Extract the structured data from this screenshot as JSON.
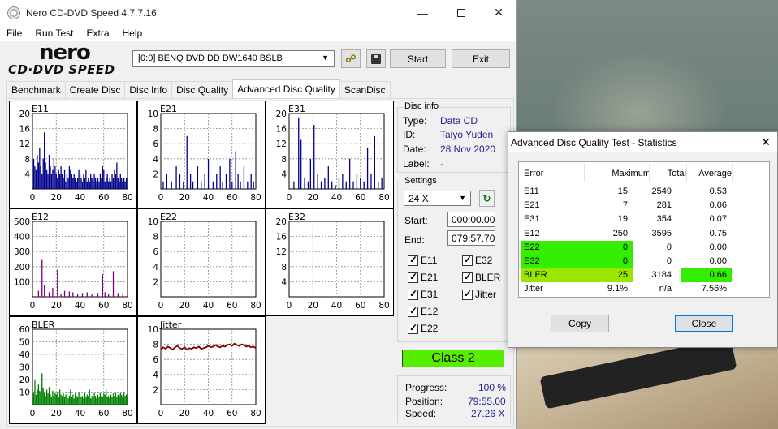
{
  "window": {
    "title": "Nero CD-DVD Speed 4.7.7.16"
  },
  "logo": {
    "line1": "nero",
    "line2": "CD·DVD SPEED"
  },
  "menu": [
    "File",
    "Run Test",
    "Extra",
    "Help"
  ],
  "toolbar": {
    "drive": "[0:0]   BENQ DVD DD DW1640 BSLB",
    "start_label": "Start",
    "exit_label": "Exit"
  },
  "tabs": [
    "Benchmark",
    "Create Disc",
    "Disc Info",
    "Disc Quality",
    "Advanced Disc Quality",
    "ScanDisc"
  ],
  "active_tab": "Advanced Disc Quality",
  "chart_data": [
    {
      "type": "bar",
      "label": "E11",
      "color": "#00008b",
      "ylim": [
        0,
        20
      ],
      "yticks": [
        4,
        8,
        12,
        16,
        20
      ],
      "xticks": [
        0,
        20,
        40,
        60,
        80
      ],
      "x": [
        1,
        2,
        3,
        4,
        5,
        6,
        7,
        8,
        9,
        10,
        11,
        12,
        13,
        14,
        15,
        16,
        17,
        18,
        19,
        20,
        21,
        22,
        23,
        24,
        25,
        26,
        27,
        28,
        29,
        30,
        31,
        32,
        33,
        34,
        35,
        36,
        37,
        38,
        39,
        40,
        41,
        42,
        43,
        44,
        45,
        46,
        47,
        48,
        49,
        50,
        51,
        52,
        53,
        54,
        55,
        56,
        57,
        58,
        59,
        60,
        61,
        62,
        63,
        64,
        65,
        66,
        67,
        68,
        69,
        70,
        71,
        72,
        73,
        74,
        75,
        76,
        77,
        78,
        79
      ],
      "values": [
        8,
        6,
        5,
        9,
        7,
        11,
        6,
        4,
        8,
        15,
        7,
        5,
        4,
        9,
        6,
        4,
        5,
        8,
        6,
        4,
        3,
        5,
        4,
        6,
        4,
        3,
        5,
        2,
        4,
        3,
        6,
        5,
        4,
        3,
        4,
        3,
        2,
        3,
        5,
        4,
        3,
        2,
        4,
        3,
        5,
        2,
        3,
        2,
        4,
        3,
        2,
        4,
        3,
        2,
        3,
        2,
        4,
        3,
        6,
        5,
        2,
        3,
        4,
        2,
        3,
        2,
        4,
        3,
        5,
        4,
        7,
        3,
        2,
        4,
        3,
        2,
        3,
        2,
        3
      ]
    },
    {
      "type": "bar",
      "label": "E21",
      "color": "#00008b",
      "ylim": [
        0,
        10
      ],
      "yticks": [
        2,
        4,
        6,
        8,
        10
      ],
      "xticks": [
        0,
        20,
        40,
        60,
        80
      ],
      "x": [
        2,
        5,
        9,
        13,
        16,
        19,
        22,
        25,
        27,
        31,
        34,
        37,
        40,
        44,
        47,
        50,
        52,
        55,
        58,
        60,
        63,
        65,
        67,
        70,
        73,
        76,
        78
      ],
      "values": [
        1,
        2,
        1,
        3,
        2,
        1,
        7,
        2,
        1,
        3,
        1,
        2,
        4,
        1,
        2,
        3,
        1,
        2,
        4,
        1,
        5,
        2,
        1,
        3,
        1,
        2,
        1
      ]
    },
    {
      "type": "bar",
      "label": "E31",
      "color": "#00008b",
      "ylim": [
        0,
        20
      ],
      "yticks": [
        4,
        8,
        12,
        16,
        20
      ],
      "xticks": [
        0,
        20,
        40,
        60,
        80
      ],
      "x": [
        4,
        8,
        10,
        13,
        16,
        18,
        21,
        24,
        27,
        30,
        33,
        36,
        39,
        42,
        45,
        48,
        51,
        54,
        57,
        60,
        63,
        66,
        69,
        72,
        75,
        78
      ],
      "values": [
        2,
        19,
        13,
        3,
        2,
        8,
        17,
        4,
        2,
        3,
        6,
        2,
        1,
        3,
        4,
        2,
        8,
        2,
        4,
        3,
        2,
        11,
        4,
        14,
        2,
        3
      ]
    },
    {
      "type": "bar",
      "label": "E12",
      "color": "#800080",
      "ylim": [
        0,
        500
      ],
      "yticks": [
        100,
        200,
        300,
        400,
        500
      ],
      "xticks": [
        0,
        20,
        40,
        60,
        80
      ],
      "x": [
        5,
        8,
        10,
        14,
        17,
        21,
        24,
        27,
        31,
        34,
        38,
        42,
        46,
        50,
        55,
        59,
        61,
        64,
        68,
        72,
        76
      ],
      "values": [
        40,
        250,
        80,
        30,
        60,
        180,
        20,
        40,
        35,
        30,
        20,
        25,
        30,
        20,
        25,
        150,
        30,
        20,
        170,
        25,
        20
      ]
    },
    {
      "type": "bar",
      "label": "E22",
      "color": "#800080",
      "ylim": [
        0,
        10
      ],
      "yticks": [
        2,
        4,
        6,
        8,
        10
      ],
      "xticks": [
        0,
        20,
        40,
        60,
        80
      ],
      "x": [],
      "values": []
    },
    {
      "type": "bar",
      "label": "E32",
      "color": "#800080",
      "ylim": [
        0,
        20
      ],
      "yticks": [
        4,
        8,
        12,
        16,
        20
      ],
      "xticks": [
        0,
        20,
        40,
        60,
        80
      ],
      "x": [],
      "values": []
    },
    {
      "type": "bar",
      "label": "BLER",
      "color": "#008000",
      "ylim": [
        0,
        60
      ],
      "yticks": [
        10,
        20,
        30,
        40,
        50,
        60
      ],
      "xticks": [
        0,
        20,
        40,
        60,
        80
      ],
      "x": [
        1,
        2,
        3,
        4,
        5,
        6,
        7,
        8,
        9,
        10,
        11,
        12,
        13,
        14,
        15,
        16,
        17,
        18,
        19,
        20,
        21,
        22,
        23,
        24,
        25,
        26,
        27,
        28,
        29,
        30,
        31,
        32,
        33,
        34,
        35,
        36,
        37,
        38,
        39,
        40,
        41,
        42,
        43,
        44,
        45,
        46,
        47,
        48,
        49,
        50,
        51,
        52,
        53,
        54,
        55,
        56,
        57,
        58,
        59,
        60,
        61,
        62,
        63,
        64,
        65,
        66,
        67,
        68,
        69,
        70,
        71,
        72,
        73,
        74,
        75,
        76,
        77,
        78,
        79
      ],
      "values": [
        10,
        20,
        8,
        12,
        16,
        11,
        9,
        25,
        13,
        10,
        7,
        12,
        9,
        14,
        8,
        6,
        11,
        7,
        9,
        8,
        10,
        6,
        12,
        8,
        7,
        9,
        6,
        8,
        10,
        5,
        7,
        12,
        6,
        8,
        5,
        9,
        7,
        6,
        10,
        8,
        6,
        7,
        5,
        9,
        6,
        8,
        7,
        12,
        5,
        7,
        6,
        9,
        7,
        5,
        8,
        6,
        10,
        7,
        6,
        9,
        8,
        12,
        6,
        7,
        5,
        8,
        6,
        9,
        7,
        10,
        6,
        8,
        7,
        9,
        8,
        6,
        10,
        7,
        8
      ]
    },
    {
      "type": "line",
      "label": "Jitter",
      "color": "#800000",
      "ylim": [
        0,
        10
      ],
      "yticks": [
        2,
        4,
        6,
        8,
        10
      ],
      "xticks": [
        0,
        20,
        40,
        60,
        80
      ],
      "x": [
        0,
        2,
        4,
        6,
        8,
        10,
        12,
        14,
        16,
        18,
        20,
        22,
        24,
        26,
        28,
        30,
        32,
        34,
        36,
        38,
        40,
        42,
        44,
        46,
        48,
        50,
        52,
        54,
        56,
        58,
        60,
        62,
        64,
        66,
        68,
        70,
        72,
        74,
        76,
        78,
        80
      ],
      "values": [
        7.3,
        7.6,
        7.4,
        7.7,
        7.5,
        7.3,
        7.6,
        7.8,
        7.5,
        7.4,
        7.6,
        7.3,
        7.5,
        7.4,
        7.6,
        7.5,
        7.7,
        7.4,
        7.5,
        7.6,
        7.8,
        7.6,
        7.7,
        7.9,
        7.7,
        7.6,
        7.8,
        7.7,
        7.9,
        8.0,
        7.8,
        8.1,
        7.9,
        7.8,
        8.0,
        7.9,
        7.7,
        7.8,
        7.6,
        7.7,
        7.5
      ]
    }
  ],
  "disc_info": {
    "title": "Disc info",
    "rows": [
      {
        "label": "Type:",
        "value": "Data CD"
      },
      {
        "label": "ID:",
        "value": "Taiyo Yuden"
      },
      {
        "label": "Date:",
        "value": "28 Nov 2020"
      },
      {
        "label": "Label:",
        "value": "-"
      }
    ]
  },
  "settings": {
    "title": "Settings",
    "speed": "24 X",
    "start_label": "Start:",
    "start_value": "000:00.00",
    "end_label": "End:",
    "end_value": "079:57.70",
    "checks": [
      {
        "label": "E11",
        "checked": true
      },
      {
        "label": "E32",
        "checked": true
      },
      {
        "label": "E21",
        "checked": true
      },
      {
        "label": "BLER",
        "checked": true
      },
      {
        "label": "E31",
        "checked": true
      },
      {
        "label": "Jitter",
        "checked": true
      },
      {
        "label": "E12",
        "checked": true
      },
      {
        "label": "E22",
        "checked": true
      }
    ]
  },
  "class_badge": "Class 2",
  "progress": {
    "progress_label": "Progress:",
    "progress_value": "100 %",
    "position_label": "Position:",
    "position_value": "79:55.00",
    "speed_label": "Speed:",
    "speed_value": "27.26 X"
  },
  "stats": {
    "title": "Advanced Disc Quality Test - Statistics",
    "headers": [
      "Error",
      "Maximum",
      "Total",
      "Average"
    ],
    "rows": [
      {
        "error": "E11",
        "maximum": "15",
        "total": "2549",
        "average": "0.53",
        "hl": ""
      },
      {
        "error": "E21",
        "maximum": "7",
        "total": "281",
        "average": "0.06",
        "hl": ""
      },
      {
        "error": "E31",
        "maximum": "19",
        "total": "354",
        "average": "0.07",
        "hl": ""
      },
      {
        "error": "E12",
        "maximum": "250",
        "total": "3595",
        "average": "0.75",
        "hl": ""
      },
      {
        "error": "E22",
        "maximum": "0",
        "total": "0",
        "average": "0.00",
        "hl": "row"
      },
      {
        "error": "E32",
        "maximum": "0",
        "total": "0",
        "average": "0.00",
        "hl": "row"
      },
      {
        "error": "BLER",
        "maximum": "25",
        "total": "3184",
        "average": "0.66",
        "hl": "bler"
      },
      {
        "error": "Jitter",
        "maximum": "9.1%",
        "total": "n/a",
        "average": "7.56%",
        "hl": ""
      }
    ],
    "copy_label": "Copy",
    "close_label": "Close"
  },
  "colors": {
    "highlight": "#33ee00",
    "class_badge": "#55ee00",
    "link_value": "#1f1f8f"
  }
}
